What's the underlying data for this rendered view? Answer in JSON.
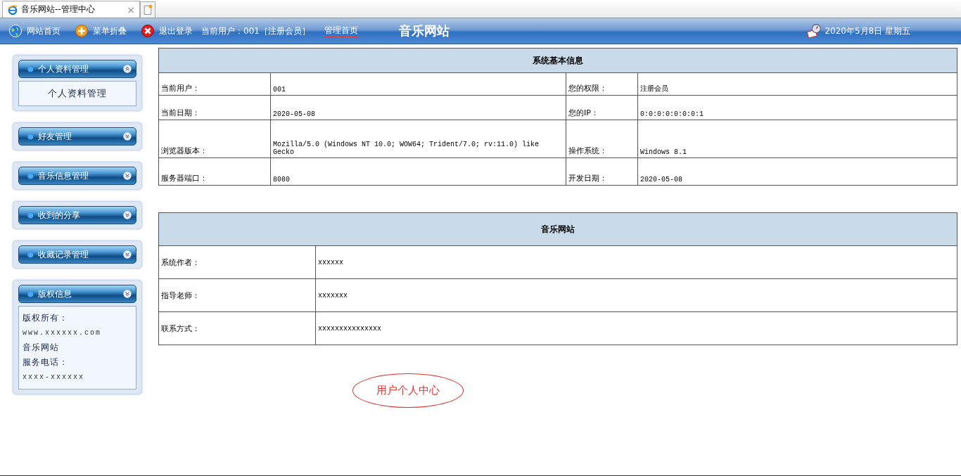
{
  "browser_tab": {
    "title": "音乐网站--管理中心",
    "close": "×"
  },
  "toolbar": {
    "links": [
      {
        "label": "网站首页",
        "kind": "globe"
      },
      {
        "label": "菜单折叠",
        "kind": "plus"
      },
      {
        "label": "退出登录",
        "kind": "exit"
      }
    ],
    "current_user": "当前用户：001［注册会员］",
    "admin_home": "管理首页",
    "site_title": "音乐网站",
    "date": "2020年5月8日 星期五"
  },
  "sidebar": {
    "panels": [
      {
        "title": "个人资料管理",
        "expanded": true,
        "items": [
          {
            "kind": "link",
            "text": "个人资料管理"
          }
        ]
      },
      {
        "title": "好友管理",
        "expanded": false
      },
      {
        "title": "音乐信息管理",
        "expanded": false
      },
      {
        "title": "收到的分享",
        "expanded": false
      },
      {
        "title": "收藏记录管理",
        "expanded": false
      },
      {
        "title": "版权信息",
        "expanded": false,
        "items": [
          {
            "kind": "text",
            "text": "版权所有："
          },
          {
            "kind": "mono",
            "text": "www.xxxxxx.com"
          },
          {
            "kind": "text",
            "text": "音乐网站"
          },
          {
            "kind": "text",
            "text": "服务电话："
          },
          {
            "kind": "mono",
            "text": "xxxx-xxxxxx"
          }
        ]
      }
    ]
  },
  "system_info": {
    "title": "系统基本信息",
    "rows": [
      [
        "当前用户：",
        "001",
        "您的权限：",
        "注册会员"
      ],
      [
        "当前日期：",
        "2020-05-08",
        "您的IP：",
        "0:0:0:0:0:0:0:1"
      ],
      [
        "浏览器版本：",
        "Mozilla/5.0 (Windows NT 10.0; WOW64; Trident/7.0; rv:11.0) like Gecko",
        "操作系统：",
        "Windows 8.1"
      ],
      [
        "服务器端口：",
        "8080",
        "开发日期：",
        "2020-05-08"
      ]
    ]
  },
  "site_info": {
    "title": "音乐网站",
    "rows": [
      [
        "系统作者：",
        "xxxxxx"
      ],
      [
        "指导老师：",
        "xxxxxxx"
      ],
      [
        "联系方式：",
        "xxxxxxxxxxxxxxx"
      ]
    ]
  },
  "user_center": "用户个人中心"
}
